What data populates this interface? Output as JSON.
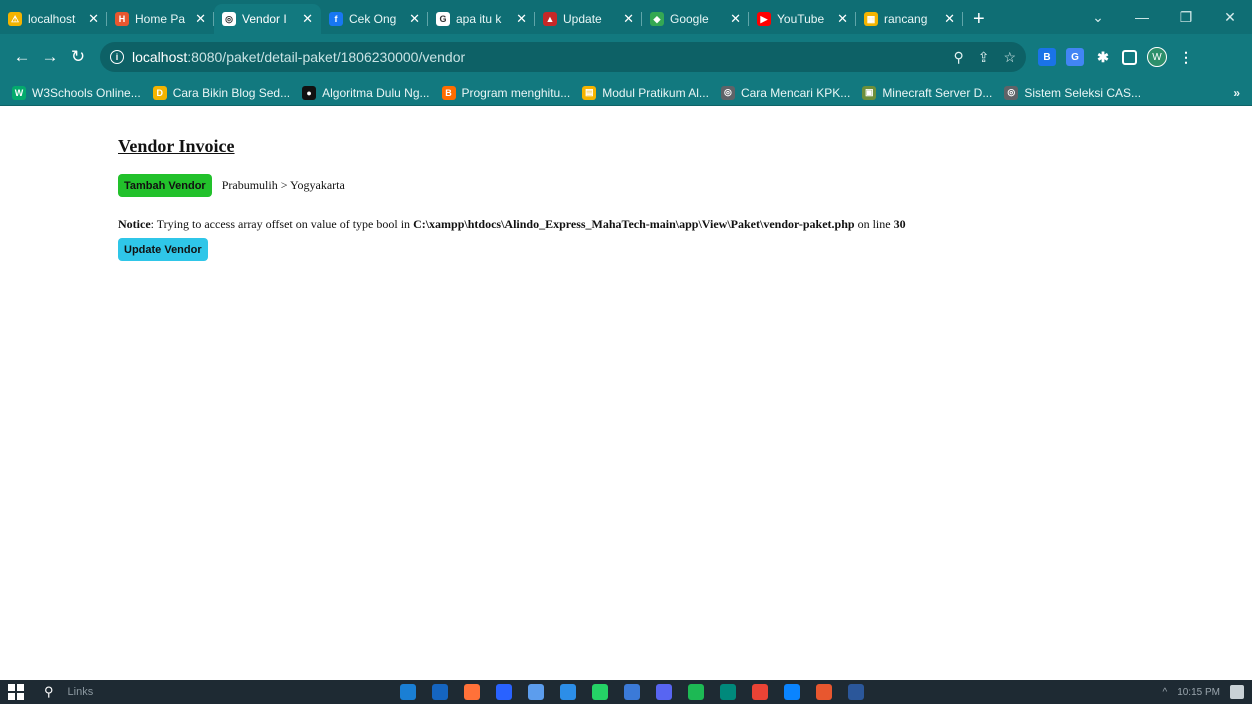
{
  "browser": {
    "tabs": [
      {
        "title": "localhost",
        "color": "#f4b400",
        "glyph": "⚠"
      },
      {
        "title": "Home Pa",
        "color": "#e8572f",
        "glyph": "H"
      },
      {
        "title": "Vendor I",
        "color": "#ffffff",
        "glyph": "◎",
        "active": true
      },
      {
        "title": "Cek Ong",
        "color": "#1877f2",
        "glyph": "f"
      },
      {
        "title": "apa itu k",
        "color": "#ffffff",
        "glyph": "G"
      },
      {
        "title": "Update",
        "color": "#c62828",
        "glyph": "▲"
      },
      {
        "title": "Google",
        "color": "#34a853",
        "glyph": "◆"
      },
      {
        "title": "YouTube",
        "color": "#ff0000",
        "glyph": "▶"
      },
      {
        "title": "rancang",
        "color": "#f4b400",
        "glyph": "▦"
      }
    ],
    "new_tab": "+",
    "url_host": "localhost",
    "url_path": ":8080/paket/detail-paket/1806230000/vendor",
    "avatar_letter": "W",
    "bookmarks": [
      {
        "label": "W3Schools Online...",
        "color": "#04aa6d",
        "glyph": "W"
      },
      {
        "label": "Cara Bikin Blog Sed...",
        "color": "#f4b400",
        "glyph": "D"
      },
      {
        "label": "Algoritma Dulu Ng...",
        "color": "#111111",
        "glyph": "●"
      },
      {
        "label": "Program menghitu...",
        "color": "#ff6d00",
        "glyph": "B"
      },
      {
        "label": "Modul Pratikum Al...",
        "color": "#f4b400",
        "glyph": "▤"
      },
      {
        "label": "Cara Mencari KPK...",
        "color": "#5f6368",
        "glyph": "◎"
      },
      {
        "label": "Minecraft Server D...",
        "color": "#6d8f3a",
        "glyph": "▣"
      },
      {
        "label": "Sistem Seleksi CAS...",
        "color": "#5f6368",
        "glyph": "◎"
      }
    ],
    "bookmarks_more": "»"
  },
  "page": {
    "title": "Vendor Invoice",
    "add_vendor_label": "Tambah Vendor",
    "route": "Prabumulih > Yogyakarta",
    "notice_label": "Notice",
    "notice_text": ": Trying to access array offset on value of type bool in ",
    "notice_path": "C:\\xampp\\htdocs\\Alindo_Express_MahaTech-main\\app\\View\\Paket\\vendor-paket.php",
    "notice_line_text": " on line ",
    "notice_line": "30",
    "update_vendor_label": "Update Vendor"
  },
  "taskbar": {
    "search_placeholder": "Links",
    "clock": "10:15 PM",
    "apps": [
      "#1a7fd4",
      "#1565c0",
      "#ff7139",
      "#2962ff",
      "#5c9ded",
      "#2c8ee8",
      "#25d366",
      "#3b7ad8",
      "#5865f2",
      "#1db954",
      "#00897b",
      "#ea4335",
      "#0a84ff",
      "#e8572f",
      "#2b579a"
    ]
  },
  "colors": {
    "accent_teal": "#12797f",
    "tambah_green": "#22c12b",
    "update_cyan": "#2fc6e8"
  }
}
